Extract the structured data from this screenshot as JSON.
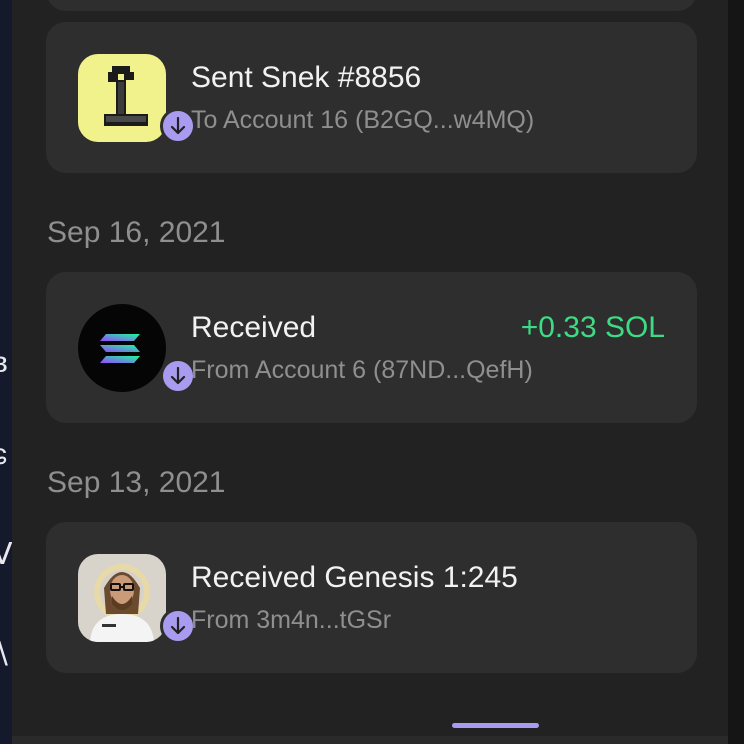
{
  "activity": {
    "items": [
      {
        "title": "Sent Snek #8856",
        "subtitle": "To Account 16 (B2GQ...w4MQ)",
        "amount": "",
        "thumbnail_icon": "snek-nft-thumbnail",
        "badge_icon": "arrow-down-icon"
      },
      {
        "date": "Sep 16, 2021",
        "title": "Received",
        "subtitle": "From Account 6 (87ND...QefH)",
        "amount": "+0.33 SOL",
        "thumbnail_icon": "solana-logo-icon",
        "badge_icon": "arrow-down-icon"
      },
      {
        "date": "Sep 13, 2021",
        "title": "Received Genesis 1:245",
        "subtitle": "From 3m4n...tGSr",
        "amount": "",
        "thumbnail_icon": "genesis-nft-thumbnail",
        "badge_icon": "arrow-down-icon"
      }
    ]
  },
  "colors": {
    "panel_background": "#222222",
    "card_background": "#2e2e2e",
    "accent_purple": "#a99cf0",
    "positive_green": "#3ddc84",
    "secondary_text": "#8f8f8f",
    "snek_background": "#f2f28c"
  }
}
